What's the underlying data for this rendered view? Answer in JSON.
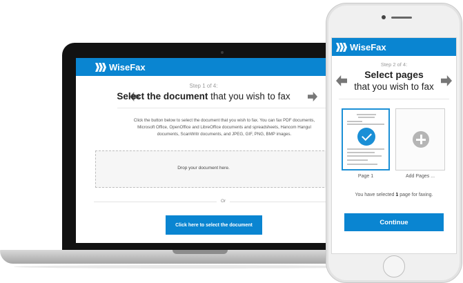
{
  "brand": {
    "name": "WiseFax",
    "color": "#0a85d1"
  },
  "laptop": {
    "step": "Step 1 of 4:",
    "title_bold": "Select the document",
    "title_rest": " that you wish to fax",
    "description_lines": [
      "Click the button below to select the document that you wish to fax. You can fax PDF documents,",
      "Microsoft Office, OpenOffice and LibreOffice documents and spreadsheets, Hancom Hangul",
      "documents, ScanWritr documents, and JPEG, GIF, PNG, BMP images."
    ],
    "drop_text": "Drop your document here.",
    "or_text": "Or",
    "select_button": "Click here to select the document"
  },
  "phone": {
    "step": "Step 2 of 4:",
    "title_line1": "Select pages",
    "title_line2": "that you wish to fax",
    "pages": [
      {
        "caption": "Page 1",
        "selected": true
      },
      {
        "caption": "Add Pages ...",
        "selected": false
      }
    ],
    "status_prefix": "You have selected ",
    "status_count": "1",
    "status_suffix": " page for faxing.",
    "continue_button": "Continue"
  }
}
